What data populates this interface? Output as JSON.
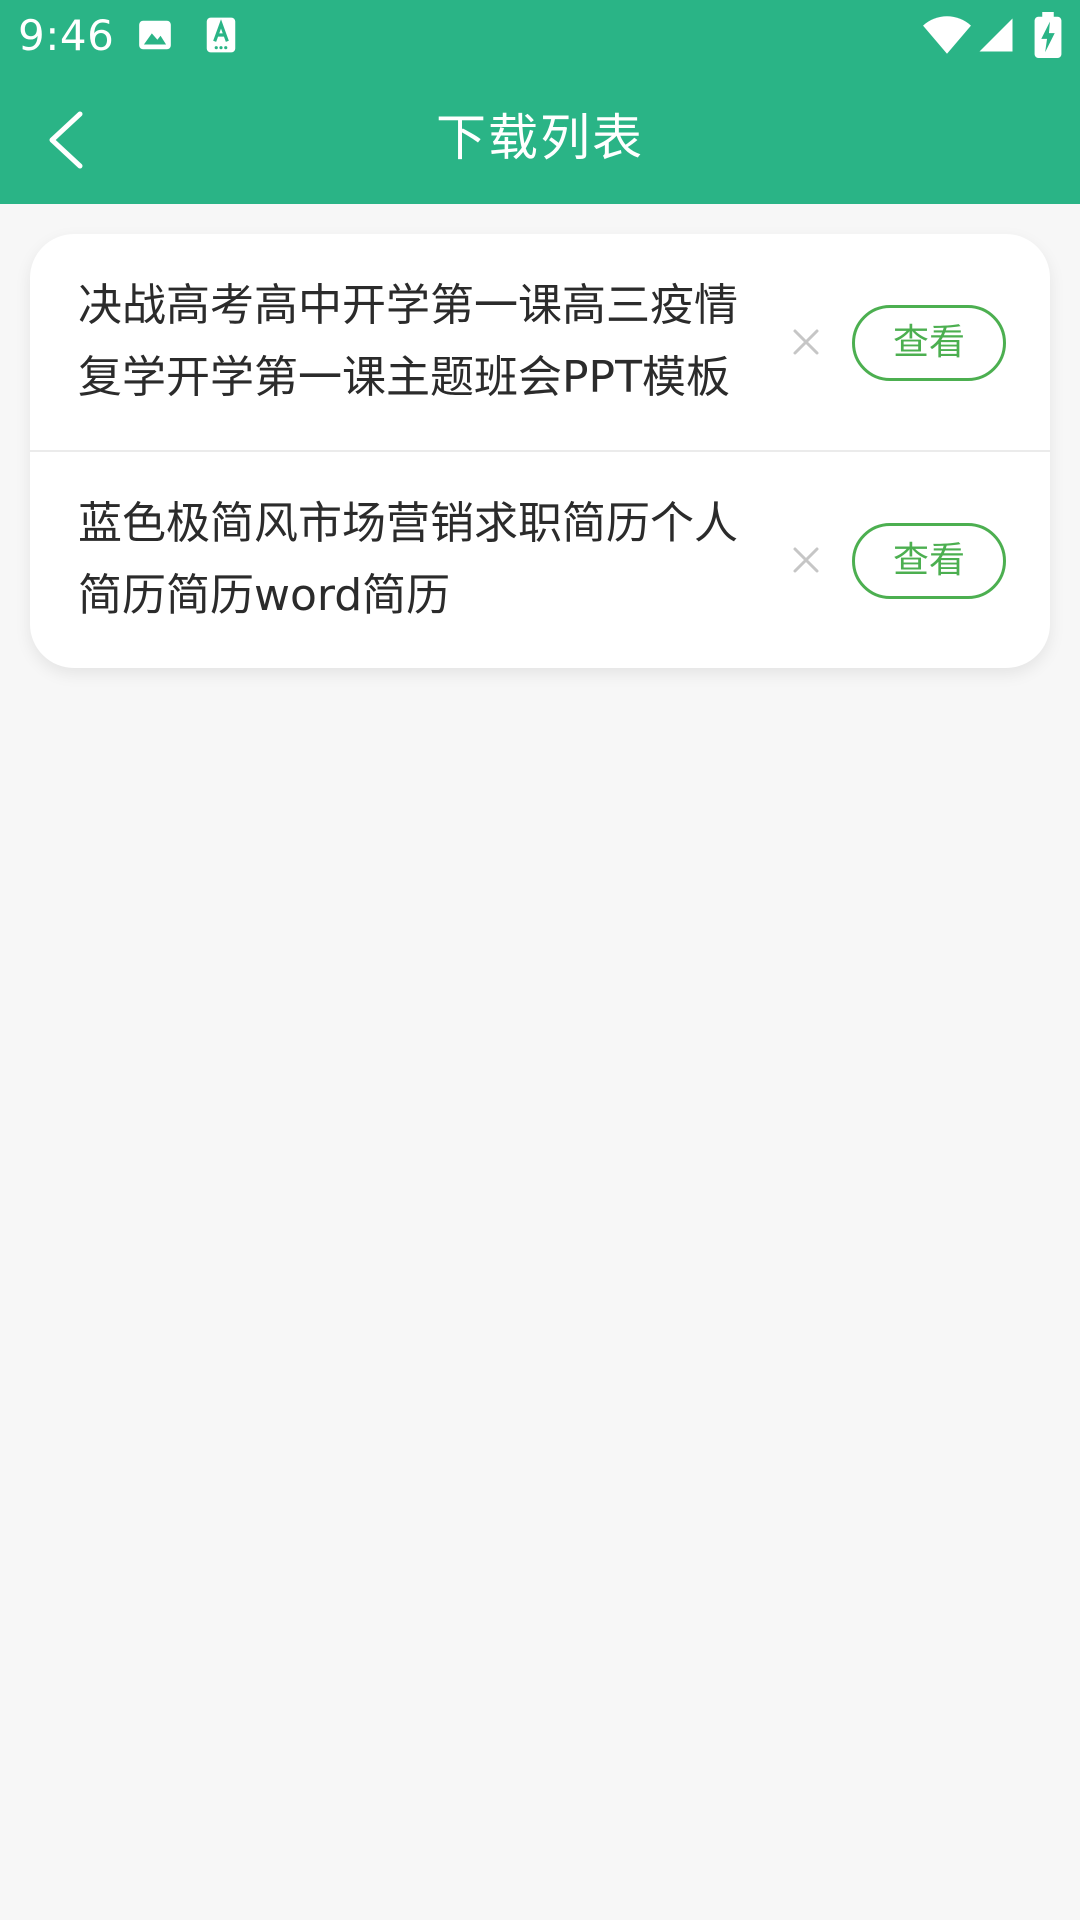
{
  "status_bar": {
    "time": "9:46",
    "notification_icons": [
      "image-icon",
      "text-scan-icon"
    ],
    "system_icons": [
      "wifi-icon",
      "signal-icon",
      "battery-charging-icon"
    ]
  },
  "app_bar": {
    "title": "下载列表",
    "back_icon": "chevron-left-icon"
  },
  "download_list": {
    "items": [
      {
        "title": "决战高考高中开学第一课高三疫情复学开学第一课主题班会PPT模板",
        "view_label": "查看",
        "delete_icon": "close-icon"
      },
      {
        "title": "蓝色极简风市场营销求职简历个人简历简历word简历",
        "view_label": "查看",
        "delete_icon": "close-icon"
      }
    ]
  },
  "colors": {
    "primary": "#2ab486",
    "button_accent": "#4caf50",
    "background": "#f7f7f7",
    "card": "#ffffff",
    "text": "#2b2b2b",
    "delete_icon": "#c6c6c6"
  }
}
